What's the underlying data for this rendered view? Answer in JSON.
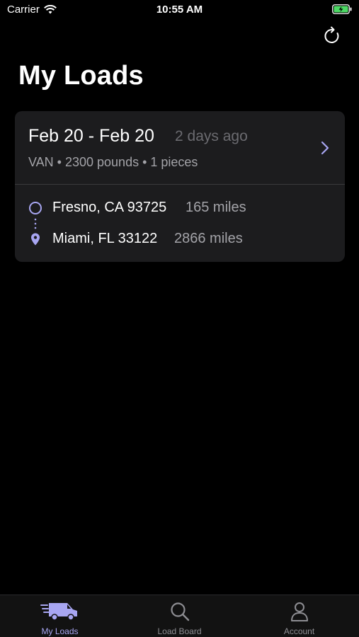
{
  "status_bar": {
    "carrier": "Carrier",
    "time": "10:55 AM"
  },
  "header": {
    "title": "My Loads",
    "refresh_icon": "refresh-icon"
  },
  "load": {
    "date_range": "Feb 20 - Feb 20",
    "ago": "2 days ago",
    "details": "VAN • 2300 pounds • 1 pieces",
    "origin": {
      "city": "Fresno, CA 93725",
      "miles": "165 miles"
    },
    "destination": {
      "city": "Miami, FL 33122",
      "miles": "2866 miles"
    }
  },
  "tabs": [
    {
      "label": "My Loads",
      "icon": "truck-icon",
      "active": true
    },
    {
      "label": "Load Board",
      "icon": "search-icon",
      "active": false
    },
    {
      "label": "Account",
      "icon": "person-icon",
      "active": false
    }
  ],
  "colors": {
    "accent": "#a8a6f2",
    "inactive": "#8e8e93",
    "card": "#1c1c1e",
    "battery": "#4cd964"
  }
}
